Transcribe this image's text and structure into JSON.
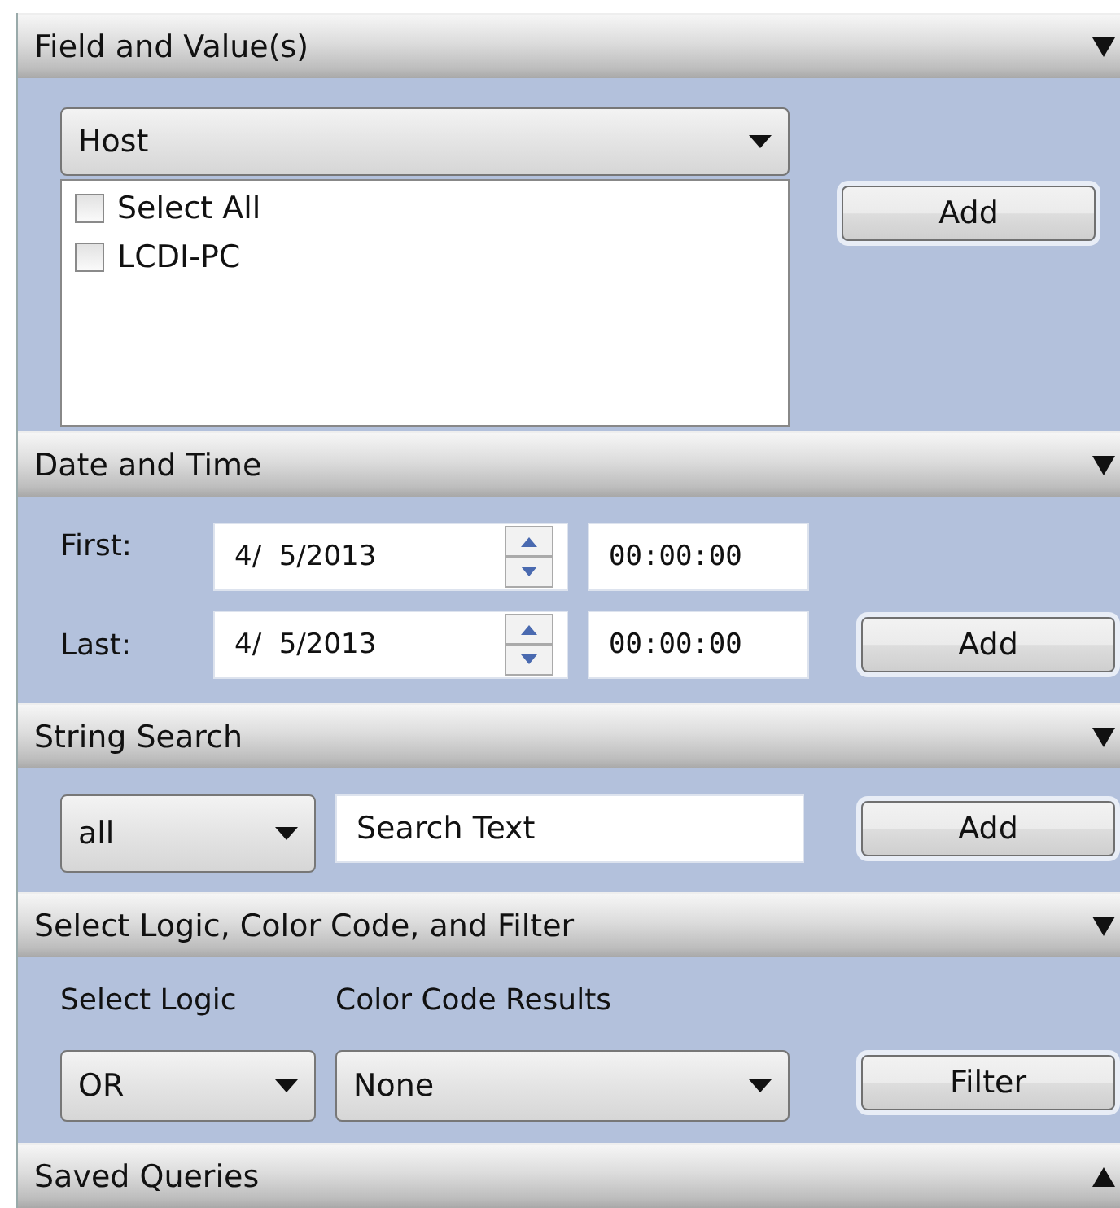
{
  "sections": [
    {
      "kind": "field",
      "title": "Field and Value(s)",
      "expanded": true,
      "field": "Host",
      "values": [
        {
          "label": "Select All",
          "checked": false
        },
        {
          "label": "LCDI-PC",
          "checked": false
        }
      ],
      "button": "Add"
    },
    {
      "kind": "datetime",
      "title": "Date and Time",
      "expanded": true,
      "rows": [
        {
          "label": "First:",
          "date": "4/  5/2013",
          "time": "00:00:00"
        },
        {
          "label": "Last:",
          "date": "4/  5/2013",
          "time": "00:00:00"
        }
      ],
      "button": "Add"
    },
    {
      "kind": "string",
      "title": "String Search",
      "expanded": true,
      "mode": "all",
      "text": "Search Text",
      "button": "Add"
    },
    {
      "kind": "logic",
      "title": "Select Logic, Color Code, and Filter",
      "expanded": true,
      "logic_label": "Select Logic",
      "logic": "OR",
      "color_label": "Color Code Results",
      "color_code": "None",
      "button": "Filter"
    },
    {
      "title": "Saved Queries",
      "expanded": false
    }
  ]
}
